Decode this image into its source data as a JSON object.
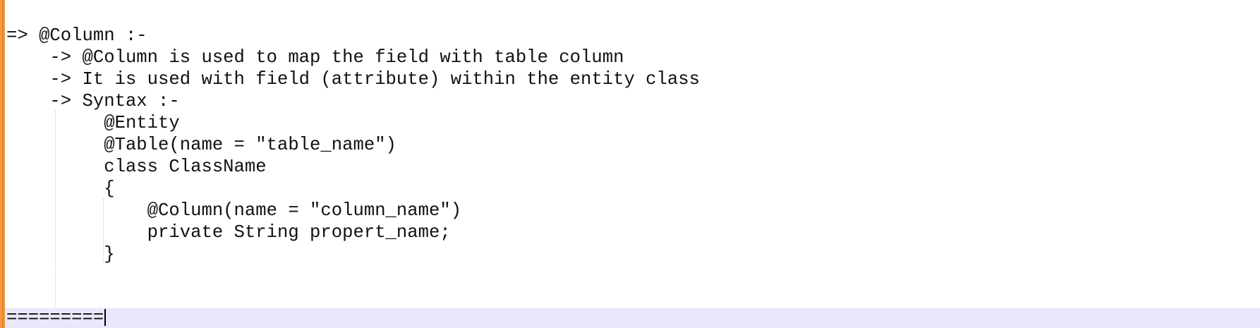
{
  "editor": {
    "lines": [
      "=> @Column :-",
      "    -> @Column is used to map the field with table column",
      "    -> It is used with field (attribute) within the entity class",
      "    -> Syntax :-",
      "         @Entity",
      "         @Table(name = \"table_name\")",
      "         class ClassName",
      "         {",
      "             @Column(name = \"column_name\")",
      "             private String propert_name;",
      "         }",
      "",
      "========="
    ]
  },
  "colors": {
    "margin_marker": "#f39a43",
    "current_line_highlight": "#e8e8fa",
    "text": "#111111"
  }
}
